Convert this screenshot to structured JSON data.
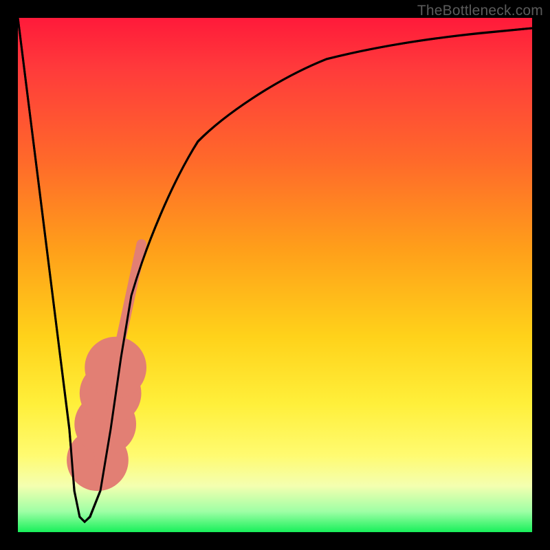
{
  "watermark": "TheBottleneck.com",
  "chart_data": {
    "type": "line",
    "title": "",
    "xlabel": "",
    "ylabel": "",
    "xlim": [
      0,
      100
    ],
    "ylim": [
      0,
      100
    ],
    "grid": false,
    "legend": false,
    "series": [
      {
        "name": "bottleneck-curve",
        "x": [
          0,
          2,
          4,
          6,
          8,
          10,
          11,
          12,
          13,
          14,
          16,
          18,
          20,
          22,
          25,
          30,
          35,
          40,
          50,
          60,
          70,
          80,
          90,
          100
        ],
        "y": [
          100,
          84,
          68,
          52,
          36,
          20,
          8,
          3,
          2,
          3,
          8,
          20,
          34,
          46,
          56,
          68,
          76,
          81,
          88,
          92,
          94.5,
          96,
          97,
          98
        ]
      }
    ],
    "markers": {
      "name": "highlight-segment",
      "style": "thick-salmon",
      "points": [
        {
          "x": 15.5,
          "y": 14
        },
        {
          "x": 17.0,
          "y": 21
        },
        {
          "x": 18.0,
          "y": 27
        },
        {
          "x": 19.0,
          "y": 32
        }
      ],
      "band": {
        "x0": 19.5,
        "y0": 35,
        "x1": 24.0,
        "y1": 56
      }
    },
    "background_gradient": {
      "top": "#ff1a3a",
      "mid": "#ffd21a",
      "bottom": "#18f05a"
    }
  }
}
